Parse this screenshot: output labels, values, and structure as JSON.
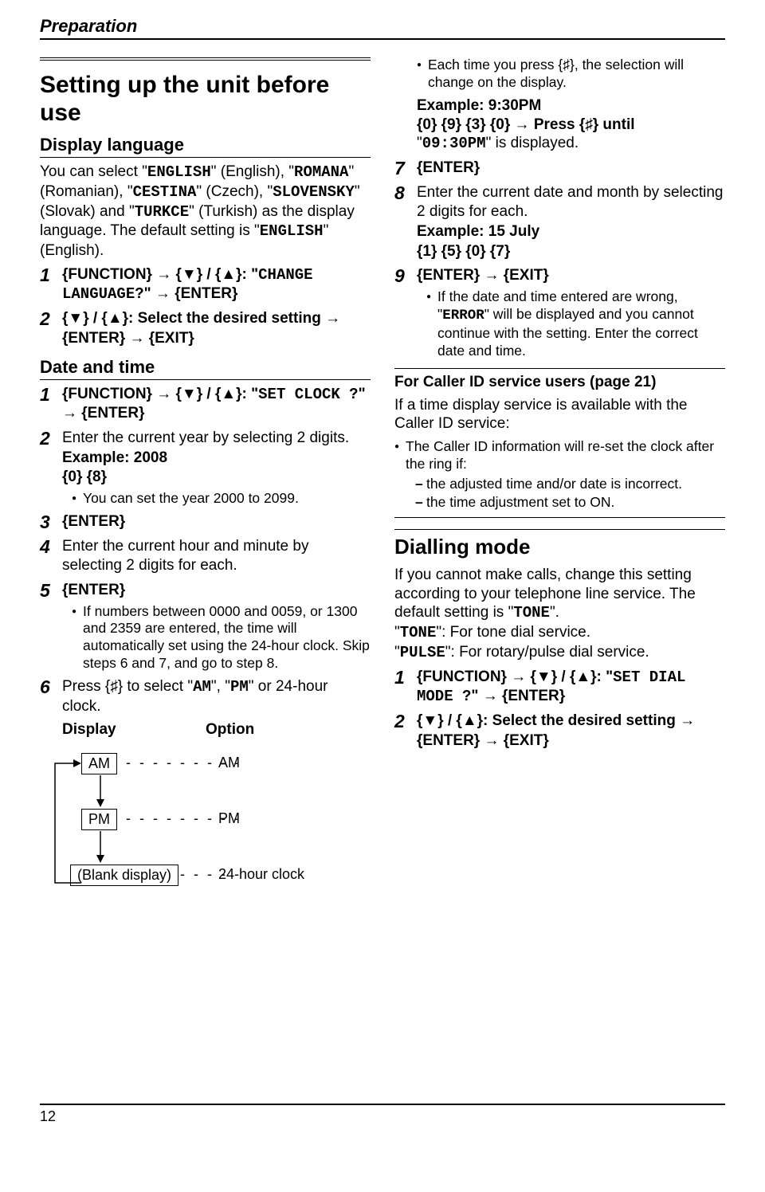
{
  "header": "Preparation",
  "page_number": "12",
  "left": {
    "title": "Setting up the unit before use",
    "display_lang_heading": "Display language",
    "lang_intro_1": "You can select \"",
    "lang_eng": "ENGLISH",
    "lang_intro_2": "\" (English), \"",
    "lang_rom": "ROMANA",
    "lang_intro_3": "\" (Romanian), \"",
    "lang_ces": "CESTINA",
    "lang_intro_4": "\" (Czech), \"",
    "lang_slo": "SLOVENSKY",
    "lang_intro_5": "\" (Slovak) and \"",
    "lang_tur": "TURKCE",
    "lang_intro_6": "\" (Turkish) as the display language. The default setting is \"",
    "lang_intro_7": "\" (English).",
    "step1_a": "{FUNCTION}",
    "step1_b": " → {▼} / {▲}: \"",
    "step1_c": "CHANGE LANGUAGE?",
    "step1_d": "\" → {ENTER}",
    "step2": "{▼} / {▲}: Select the desired setting → {ENTER} → {EXIT}",
    "date_heading": "Date and time",
    "dt_step1_a": "{FUNCTION}",
    "dt_step1_b": " → {▼} / {▲}: \"",
    "dt_step1_c": "SET CLOCK ?",
    "dt_step1_d": "\" → {ENTER}",
    "dt_step2": "Enter the current year by selecting 2 digits.",
    "dt_step2_ex": "Example: 2008",
    "dt_step2_keys": "{0} {8}",
    "dt_step2_note": "You can set the year 2000 to 2099.",
    "dt_step3": "{ENTER}",
    "dt_step4": "Enter the current hour and minute by selecting 2 digits for each.",
    "dt_step5": "{ENTER}",
    "dt_step5_note": "If numbers between 0000 and 0059, or 1300 and 2359 are entered, the time will automatically set using the 24-hour clock. Skip steps 6 and 7, and go to step 8.",
    "dt_step6_a": "Press {♯} to select \"",
    "dt_step6_am": "AM",
    "dt_step6_b": "\", \"",
    "dt_step6_pm": "PM",
    "dt_step6_c": "\" or 24-hour clock.",
    "table_display": "Display",
    "table_option": "Option",
    "diag_am": "AM",
    "diag_pm": "PM",
    "diag_blank": "(Blank display)",
    "diag_24": "24-hour clock",
    "diag_opt_am": "AM",
    "diag_opt_pm": "PM"
  },
  "right": {
    "note_hash": "Each time you press {♯}, the selection will change on the display.",
    "ex_label": "Example: 9:30PM",
    "ex_keys": "{0} {9} {3} {0} → Press {♯} until",
    "ex_disp_a": "\"",
    "ex_disp_val": "09:30PM",
    "ex_disp_b": "\" is displayed.",
    "step7": "{ENTER}",
    "step8": "Enter the current date and month by selecting 2 digits for each.",
    "step8_ex": "Example: 15 July",
    "step8_keys": "{1} {5} {0} {7}",
    "step9": "{ENTER} → {EXIT}",
    "step9_note_a": "If the date and time entered are wrong, \"",
    "step9_err": "ERROR",
    "step9_note_b": "\" will be displayed and you cannot continue with the setting. Enter the correct date and time.",
    "callout_title": "For Caller ID service users (page 21)",
    "callout_body": "If a time display service is available with the Caller ID service:",
    "callout_b1": "The Caller ID information will re-set the clock after the ring if:",
    "callout_d1": "the adjusted time and/or date is incorrect.",
    "callout_d2": "the time adjustment set to ON.",
    "dial_heading": "Dialling mode",
    "dial_intro_a": "If you cannot make calls, change this setting according to your telephone line service. The default setting is \"",
    "dial_tone": "TONE",
    "dial_intro_b": "\".",
    "dial_tone_desc_a": "\"",
    "dial_tone_desc_b": "\": For tone dial service.",
    "dial_pulse": "PULSE",
    "dial_pulse_desc": "\": For rotary/pulse dial service.",
    "dial_step1_a": "{FUNCTION}",
    "dial_step1_b": " → {▼} / {▲}: \"",
    "dial_step1_c": "SET DIAL MODE ?",
    "dial_step1_d": "\" → {ENTER}",
    "dial_step2": "{▼} / {▲}: Select the desired setting → {ENTER} → {EXIT}"
  }
}
